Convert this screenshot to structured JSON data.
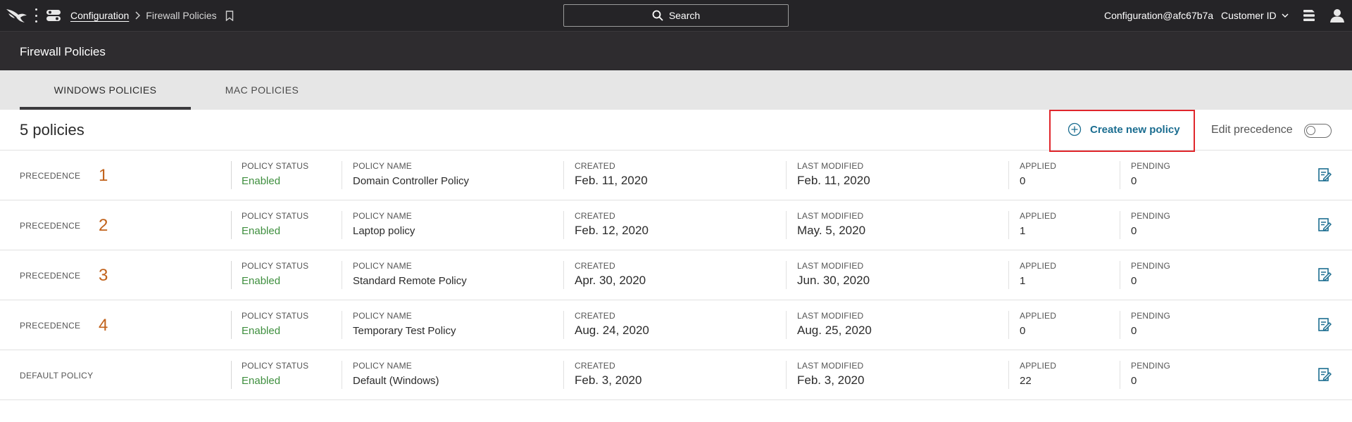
{
  "nav": {
    "breadcrumb_parent": "Configuration",
    "breadcrumb_current": "Firewall Policies",
    "search_label": "Search",
    "account": "Configuration@afc67b7a",
    "customer_label": "Customer ID",
    "icons": [
      "falcon-logo-icon",
      "kebab-menu-icon",
      "menu-toggle-icon",
      "chevron-right-icon",
      "bookmark-icon",
      "search-icon",
      "chevron-down-icon",
      "notifications-icon",
      "user-icon"
    ]
  },
  "page": {
    "title": "Firewall Policies"
  },
  "tabs": [
    {
      "label": "WINDOWS POLICIES",
      "active": true
    },
    {
      "label": "MAC POLICIES",
      "active": false
    }
  ],
  "toolbar": {
    "count": "5 policies",
    "create_label": "Create new policy",
    "edit_precedence_label": "Edit precedence",
    "edit_precedence_on": false
  },
  "columns": {
    "status": "POLICY STATUS",
    "name": "POLICY NAME",
    "created": "CREATED",
    "modified": "LAST MODIFIED",
    "applied": "APPLIED",
    "pending": "PENDING"
  },
  "colors": {
    "topbar": "#252427",
    "header": "#2e2c2f",
    "accent_link": "#1b6d90",
    "precedence_number": "#c1621b",
    "status_enabled": "#3f8f3f",
    "highlight_box": "#e0262b"
  },
  "policies": [
    {
      "precedence_label": "PRECEDENCE",
      "precedence": "1",
      "status": "Enabled",
      "name": "Domain Controller Policy",
      "created": "Feb. 11, 2020",
      "modified": "Feb. 11, 2020",
      "applied": "0",
      "pending": "0"
    },
    {
      "precedence_label": "PRECEDENCE",
      "precedence": "2",
      "status": "Enabled",
      "name": "Laptop policy",
      "created": "Feb. 12, 2020",
      "modified": "May. 5, 2020",
      "applied": "1",
      "pending": "0"
    },
    {
      "precedence_label": "PRECEDENCE",
      "precedence": "3",
      "status": "Enabled",
      "name": "Standard Remote Policy",
      "created": "Apr. 30, 2020",
      "modified": "Jun. 30, 2020",
      "applied": "1",
      "pending": "0"
    },
    {
      "precedence_label": "PRECEDENCE",
      "precedence": "4",
      "status": "Enabled",
      "name": "Temporary Test Policy",
      "created": "Aug. 24, 2020",
      "modified": "Aug. 25, 2020",
      "applied": "0",
      "pending": "0"
    },
    {
      "precedence_label": "DEFAULT POLICY",
      "precedence": "",
      "status": "Enabled",
      "name": "Default (Windows)",
      "created": "Feb. 3, 2020",
      "modified": "Feb. 3, 2020",
      "applied": "22",
      "pending": "0"
    }
  ]
}
